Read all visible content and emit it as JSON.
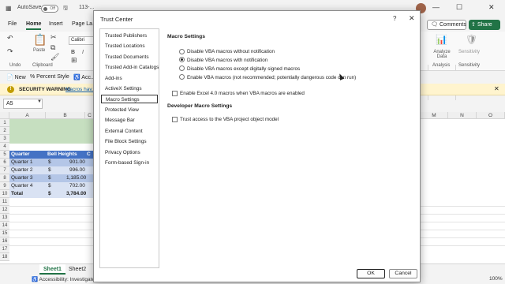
{
  "titlebar": {
    "autosave": "AutoSave",
    "toggle": "Off",
    "filename": "113-..."
  },
  "menu": {
    "tabs": [
      "File",
      "Home",
      "Insert",
      "Page La..."
    ],
    "comments": "Comments",
    "share": "Share"
  },
  "ribbon": {
    "groups": [
      "Undo",
      "Clipboard",
      "Analysis",
      "Sensitivity"
    ],
    "paste": "Paste",
    "font_box": "Calibri",
    "bold": "B",
    "italic": "I",
    "analyze": "Analyze Data",
    "sensitivity": "Sensitivity"
  },
  "quickbar": [
    "New",
    "Percent Style",
    "Acc..."
  ],
  "security": {
    "label": "SECURITY WARNING",
    "link": "Macros hav..."
  },
  "formula": {
    "namebox": "A5"
  },
  "grid": {
    "columns": [
      "A",
      "B",
      "C",
      "M",
      "N",
      "O"
    ],
    "rows": [
      "1",
      "2",
      "3",
      "4",
      "5",
      "6",
      "7",
      "8",
      "9",
      "10",
      "11",
      "12",
      "13",
      "14",
      "15",
      "16",
      "17",
      "18"
    ],
    "table": {
      "headers": [
        "Quarter",
        "Bell Heights",
        "C"
      ],
      "rows": [
        {
          "quarter": "Quarter 1",
          "currency": "$",
          "amount": "901.00"
        },
        {
          "quarter": "Quarter 2",
          "currency": "$",
          "amount": "996.00"
        },
        {
          "quarter": "Quarter 3",
          "currency": "$",
          "amount": "1,185.00"
        },
        {
          "quarter": "Quarter 4",
          "currency": "$",
          "amount": "702.00"
        },
        {
          "quarter": "Total",
          "currency": "$",
          "amount": "3,784.00"
        }
      ]
    }
  },
  "sheets": [
    "Sheet1",
    "Sheet2"
  ],
  "status": {
    "accessibility": "Accessibility: Investigate",
    "zoom": "100%"
  },
  "dialog": {
    "title": "Trust Center",
    "nav": [
      "Trusted Publishers",
      "Trusted Locations",
      "Trusted Documents",
      "Trusted Add-in Catalogs",
      "Add-ins",
      "ActiveX Settings",
      "Macro Settings",
      "Protected View",
      "Message Bar",
      "External Content",
      "File Block Settings",
      "Privacy Options",
      "Form-based Sign-in"
    ],
    "macro_heading": "Macro Settings",
    "macro_options": [
      "Disable VBA macros without notification",
      "Disable VBA macros with notification",
      "Disable VBA macros except digitally signed macros",
      "Enable VBA macros (not recommended; potentially dangerous code can run)"
    ],
    "excel4": "Enable Excel 4.0 macros when VBA macros are enabled",
    "dev_heading": "Developer Macro Settings",
    "vba_access": "Trust access to the VBA project object model",
    "ok": "OK",
    "cancel": "Cancel"
  }
}
